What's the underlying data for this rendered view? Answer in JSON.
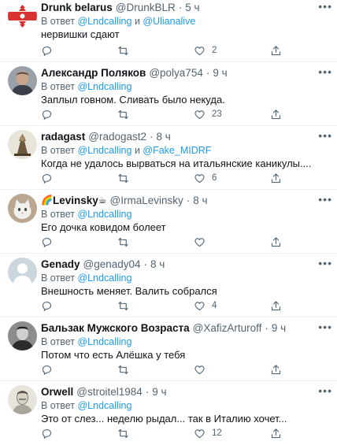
{
  "tweets": [
    {
      "name": "Drunk belarus",
      "handle": "@DrunkBLR",
      "time": "5 ч",
      "reply_prefix": "В ответ",
      "mentions": [
        "@Lndcalling",
        "@Ulianalive"
      ],
      "mention_joiner": "и",
      "text": "нервишки сдают",
      "reply_count": "",
      "retweet_count": "",
      "like_count": "2",
      "avatar": "red-white-flag-avatar"
    },
    {
      "name": "Александр Поляков",
      "handle": "@polya754",
      "time": "9 ч",
      "reply_prefix": "В ответ",
      "mentions": [
        "@Lndcalling"
      ],
      "mention_joiner": "",
      "text": "Заплыл говном. Сливать было некуда.",
      "reply_count": "",
      "retweet_count": "",
      "like_count": "23",
      "avatar": "man-photo-avatar"
    },
    {
      "name": "radagast",
      "handle": "@radogast2",
      "time": "8 ч",
      "reply_prefix": "В ответ",
      "mentions": [
        "@Lndcalling",
        "@Fake_MIDRF"
      ],
      "mention_joiner": "и",
      "text": "Когда не удалось вырваться на итальянские каникулы....",
      "reply_count": "",
      "retweet_count": "",
      "like_count": "6",
      "avatar": "figurine-avatar"
    },
    {
      "name": "Levinsky",
      "name_emoji_before": "🌈",
      "name_emoji_after": "☕",
      "handle": "@IrmaLevinsky",
      "time": "8 ч",
      "reply_prefix": "В ответ",
      "mentions": [
        "@Lndcalling"
      ],
      "mention_joiner": "",
      "text": "Его дочка ковидом болеет",
      "reply_count": "",
      "retweet_count": "",
      "like_count": "",
      "avatar": "cat-photo-avatar"
    },
    {
      "name": "Genady",
      "handle": "@genady04",
      "time": "8 ч",
      "reply_prefix": "В ответ",
      "mentions": [
        "@Lndcalling"
      ],
      "mention_joiner": "",
      "text": "Внешность меняет. Валить собрался",
      "reply_count": "",
      "retweet_count": "",
      "like_count": "4",
      "avatar": "default-avatar"
    },
    {
      "name": "Бальзак Мужского Возраста",
      "handle": "@XafizArturoff",
      "time": "9 ч",
      "reply_prefix": "В ответ",
      "mentions": [
        "@Lndcalling"
      ],
      "mention_joiner": "",
      "text": "Потом что есть Алёшка у тебя",
      "reply_count": "",
      "retweet_count": "",
      "like_count": "",
      "avatar": "man-bw-photo-avatar"
    },
    {
      "name": "Orwell",
      "handle": "@stroitel1984",
      "time": "9 ч",
      "reply_prefix": "В ответ",
      "mentions": [
        "@Lndcalling"
      ],
      "mention_joiner": "",
      "text": "Это от слез... неделю рыдал... так в Италию хочет...",
      "reply_count": "",
      "retweet_count": "",
      "like_count": "12",
      "avatar": "portrait-drawing-avatar"
    }
  ],
  "colors": {
    "link": "#1d9bf0",
    "muted": "#536471",
    "text": "#0f1419",
    "divider": "#eff3f4"
  },
  "icons": {
    "more": "more-dots-icon",
    "reply": "reply-icon",
    "retweet": "retweet-icon",
    "like": "like-icon",
    "share": "share-icon"
  }
}
